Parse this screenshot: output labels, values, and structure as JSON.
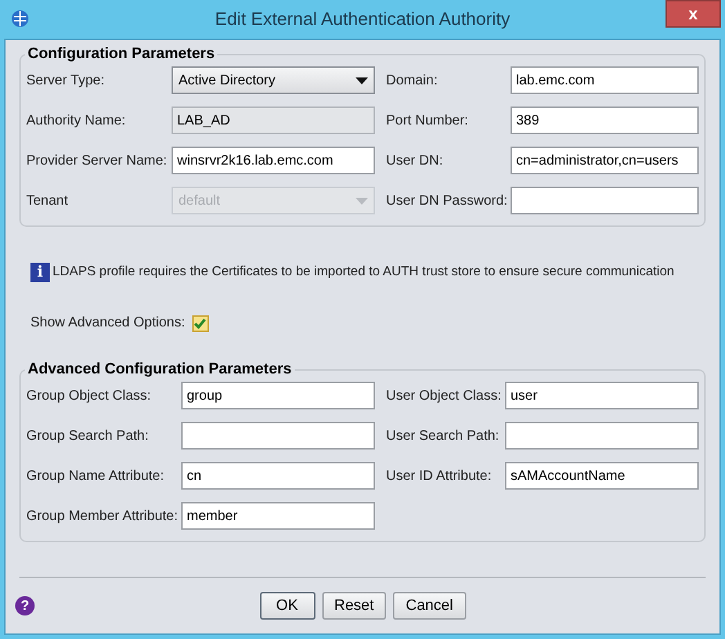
{
  "window": {
    "title": "Edit External Authentication Authority",
    "close": "x"
  },
  "config": {
    "title": "Configuration Parameters",
    "rows": [
      [
        {
          "label": "Server Type:",
          "kind": "select",
          "value": "Active Directory",
          "disabled": false
        },
        {
          "label": "Domain:",
          "kind": "text",
          "value": "lab.emc.com",
          "disabled": false
        }
      ],
      [
        {
          "label": "Authority Name:",
          "kind": "text",
          "value": "LAB_AD",
          "disabled": true
        },
        {
          "label": "Port Number:",
          "kind": "text",
          "value": "389",
          "disabled": false
        }
      ],
      [
        {
          "label": "Provider Server Name:",
          "kind": "text",
          "value": "winsrvr2k16.lab.emc.com",
          "disabled": false
        },
        {
          "label": "User DN:",
          "kind": "text",
          "value": "cn=administrator,cn=users",
          "disabled": false
        }
      ],
      [
        {
          "label": "Tenant",
          "kind": "select",
          "value": "default",
          "disabled": true
        },
        {
          "label": "User DN Password:",
          "kind": "text",
          "disabled": false
        }
      ]
    ]
  },
  "info_icon": "i",
  "info": "LDAPS profile requires the Certificates to be imported to AUTH trust store  to ensure secure communication",
  "show_advanced": {
    "label": "Show Advanced Options:",
    "checked": true
  },
  "advanced": {
    "title": "Advanced Configuration Parameters",
    "rows": [
      [
        {
          "label": "Group Object Class:",
          "kind": "text",
          "value": "group",
          "disabled": false
        },
        {
          "label": "User Object Class:",
          "kind": "text",
          "value": "user",
          "disabled": false
        }
      ],
      [
        {
          "label": "Group Search Path:",
          "kind": "text",
          "disabled": false
        },
        {
          "label": "User Search Path:",
          "kind": "text",
          "disabled": false
        }
      ],
      [
        {
          "label": "Group Name Attribute:",
          "kind": "text",
          "value": "cn",
          "disabled": false
        },
        {
          "label": "User ID Attribute:",
          "kind": "text",
          "value": "sAMAccountName",
          "disabled": false
        }
      ],
      [
        {
          "label": "Group Member Attribute:",
          "kind": "text",
          "value": "member",
          "disabled": false
        }
      ]
    ]
  },
  "help_icon": "?",
  "buttons": [
    "OK",
    "Reset",
    "Cancel"
  ]
}
